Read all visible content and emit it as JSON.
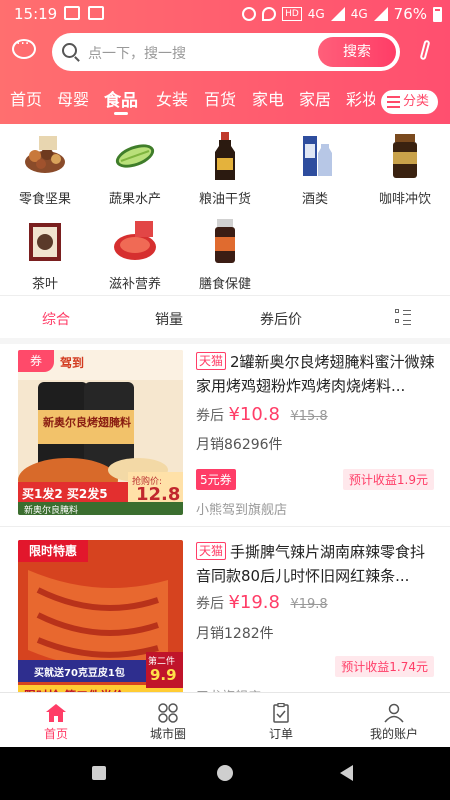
{
  "status_bar": {
    "time": "15:19",
    "network_hd": "HD",
    "network_1": "4G",
    "network_2": "4G",
    "battery_text": "76%",
    "battery_level": 0.76
  },
  "search": {
    "placeholder": "点一下，搜一搜",
    "button_label": "搜索"
  },
  "category_tabs": [
    "首页",
    "母婴",
    "食品",
    "女装",
    "百货",
    "家电",
    "家居",
    "彩妆"
  ],
  "active_category": "食品",
  "category_button_label": "分类",
  "subcategories": [
    {
      "label": "零食坚果",
      "icon": "nuts-icon"
    },
    {
      "label": "蔬果水产",
      "icon": "cucumber-icon"
    },
    {
      "label": "粮油干货",
      "icon": "soy-sauce-icon"
    },
    {
      "label": "酒类",
      "icon": "liquor-icon"
    },
    {
      "label": "咖啡冲饮",
      "icon": "coffee-jar-icon"
    },
    {
      "label": "茶叶",
      "icon": "tea-box-icon"
    },
    {
      "label": "滋补营养",
      "icon": "nutrition-icon"
    },
    {
      "label": "膳食保健",
      "icon": "supplement-bottle-icon"
    }
  ],
  "sort_tabs": [
    "综合",
    "销量",
    "券后价"
  ],
  "active_sort": "综合",
  "products": [
    {
      "platform_tag": "天猫",
      "title": "2罐新奥尔良烤翅腌料蜜汁微辣家用烤鸡翅粉炸鸡烤肉烧烤料...",
      "price_prefix": "券后",
      "price": "¥10.8",
      "original_price": "¥15.8",
      "sales": "月销86296件",
      "coupon": "5元券",
      "profit": "预计收益1.9元",
      "shop": "小熊驾到旗舰店",
      "image": {
        "corner_badge": "券",
        "brand_text": "驾到",
        "jar_label": "新奥尔良烤翅腌料",
        "promo_text": "买1发2 买2发5",
        "sub_text": "新奥尔良腌料",
        "price_label": "抢购价:",
        "price_value": "12.8"
      }
    },
    {
      "platform_tag": "天猫",
      "title": "手撕脾气辣片湖南麻辣零食抖音同款80后儿时怀旧网红辣条...",
      "price_prefix": "券后",
      "price": "¥19.8",
      "original_price": "¥19.8",
      "sales": "月销1282件",
      "profit": "预计收益1.74元",
      "shop": "卫龙旗舰店",
      "image": {
        "corner_badge": "限时特惠",
        "promo_text": "买就送70克豆皮1包",
        "second_label": "第二件",
        "second_price": "9.9",
        "bottom_text": "限时抢 第二件半价"
      }
    }
  ],
  "bottom_nav": [
    {
      "label": "首页",
      "icon": "home-icon"
    },
    {
      "label": "城市圈",
      "icon": "city-circle-icon"
    },
    {
      "label": "订单",
      "icon": "order-clipboard-icon"
    },
    {
      "label": "我的账户",
      "icon": "account-user-icon"
    }
  ],
  "active_nav": "首页",
  "colors": {
    "accent": "#ff3d67",
    "header_gradient_start": "#ff6f6f",
    "header_gradient_end": "#ff4f6f"
  }
}
